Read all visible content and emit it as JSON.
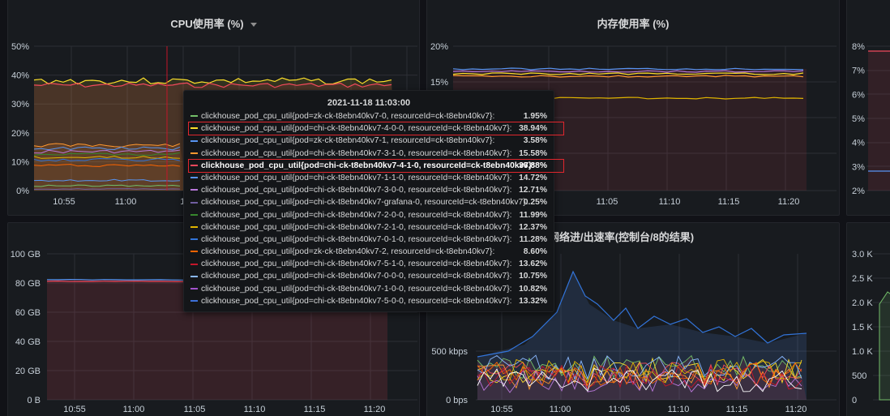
{
  "panels": {
    "cpu": {
      "title": "CPU使用率 (%)",
      "y_ticks": [
        "50%",
        "40%",
        "30%",
        "20%",
        "10%",
        "0%"
      ],
      "x_ticks": [
        "10:55",
        "11:00",
        "11"
      ]
    },
    "mem": {
      "title": "内存使用率 (%)",
      "y_ticks": [
        "20%",
        "15%"
      ],
      "x_ticks": [
        "11:05",
        "11:10",
        "11:15",
        "11:20"
      ]
    },
    "right_top": {
      "y_ticks": [
        "8%",
        "7%",
        "6%",
        "5%",
        "4%",
        "3%",
        "2%"
      ]
    },
    "disk": {
      "y_ticks": [
        "100 GB",
        "80 GB",
        "60 GB",
        "40 GB",
        "20 GB",
        "0 B"
      ],
      "x_ticks": [
        "10:55",
        "11:00",
        "11:05",
        "11:10",
        "11:15",
        "11:20"
      ]
    },
    "net": {
      "title": "网络进/出速率(控制台/8的结果)",
      "y_ticks": [
        "500 kbps",
        "0 bps"
      ],
      "x_ticks": [
        "10:55",
        "11:00",
        "11:05",
        "11:10",
        "11:15",
        "11:20"
      ]
    },
    "right_bottom": {
      "y_ticks": [
        "3.0 K",
        "2.5 K",
        "2.0 K",
        "1.5 K",
        "1.0 K",
        "500",
        "0"
      ]
    }
  },
  "tooltip": {
    "time": "2021-11-18 11:03:00",
    "rows": [
      {
        "label": "clickhouse_pod_cpu_util{pod=zk-ck-t8ebn40kv7-0, resourceId=ck-t8ebn40kv7}:",
        "value": "1.95%",
        "color": "#73bf69"
      },
      {
        "label": "clickhouse_pod_cpu_util{pod=chi-ck-t8ebn40kv7-4-0-0, resourceId=ck-t8ebn40kv7}:",
        "value": "38.94%",
        "color": "#fade2a"
      },
      {
        "label": "clickhouse_pod_cpu_util{pod=zk-ck-t8ebn40kv7-1, resourceId=ck-t8ebn40kv7}:",
        "value": "3.58%",
        "color": "#5794f2"
      },
      {
        "label": "clickhouse_pod_cpu_util{pod=chi-ck-t8ebn40kv7-3-1-0, resourceId=ck-t8ebn40kv7}:",
        "value": "15.58%",
        "color": "#ff9830"
      },
      {
        "label": "clickhouse_pod_cpu_util{pod=chi-ck-t8ebn40kv7-4-1-0, resourceId=ck-t8ebn40kv7}:",
        "value": "36.88%",
        "color": "#f2495c"
      },
      {
        "label": "clickhouse_pod_cpu_util{pod=chi-ck-t8ebn40kv7-1-1-0, resourceId=ck-t8ebn40kv7}:",
        "value": "14.72%",
        "color": "#5794f2"
      },
      {
        "label": "clickhouse_pod_cpu_util{pod=chi-ck-t8ebn40kv7-3-0-0, resourceId=ck-t8ebn40kv7}:",
        "value": "12.71%",
        "color": "#b877d9"
      },
      {
        "label": "clickhouse_pod_cpu_util{pod=chi-ck-t8ebn40kv7-grafana-0, resourceId=ck-t8ebn40kv7}:",
        "value": "0.25%",
        "color": "#705da0"
      },
      {
        "label": "clickhouse_pod_cpu_util{pod=chi-ck-t8ebn40kv7-2-0-0, resourceId=ck-t8ebn40kv7}:",
        "value": "11.99%",
        "color": "#37872d"
      },
      {
        "label": "clickhouse_pod_cpu_util{pod=chi-ck-t8ebn40kv7-2-1-0, resourceId=ck-t8ebn40kv7}:",
        "value": "12.37%",
        "color": "#e0b400"
      },
      {
        "label": "clickhouse_pod_cpu_util{pod=chi-ck-t8ebn40kv7-0-1-0, resourceId=ck-t8ebn40kv7}:",
        "value": "11.28%",
        "color": "#3274d9"
      },
      {
        "label": "clickhouse_pod_cpu_util{pod=zk-ck-t8ebn40kv7-2, resourceId=ck-t8ebn40kv7}:",
        "value": "8.60%",
        "color": "#fa6400"
      },
      {
        "label": "clickhouse_pod_cpu_util{pod=chi-ck-t8ebn40kv7-5-1-0, resourceId=ck-t8ebn40kv7}:",
        "value": "13.62%",
        "color": "#c4162a"
      },
      {
        "label": "clickhouse_pod_cpu_util{pod=chi-ck-t8ebn40kv7-0-0-0, resourceId=ck-t8ebn40kv7}:",
        "value": "10.75%",
        "color": "#8ab8ff"
      },
      {
        "label": "clickhouse_pod_cpu_util{pod=chi-ck-t8ebn40kv7-1-0-0, resourceId=ck-t8ebn40kv7}:",
        "value": "10.82%",
        "color": "#a352cc"
      },
      {
        "label": "clickhouse_pod_cpu_util{pod=chi-ck-t8ebn40kv7-5-0-0, resourceId=ck-t8ebn40kv7}:",
        "value": "13.32%",
        "color": "#3d71d9"
      }
    ],
    "highlighted_rows": [
      1,
      4
    ],
    "bold_row": 4
  }
}
